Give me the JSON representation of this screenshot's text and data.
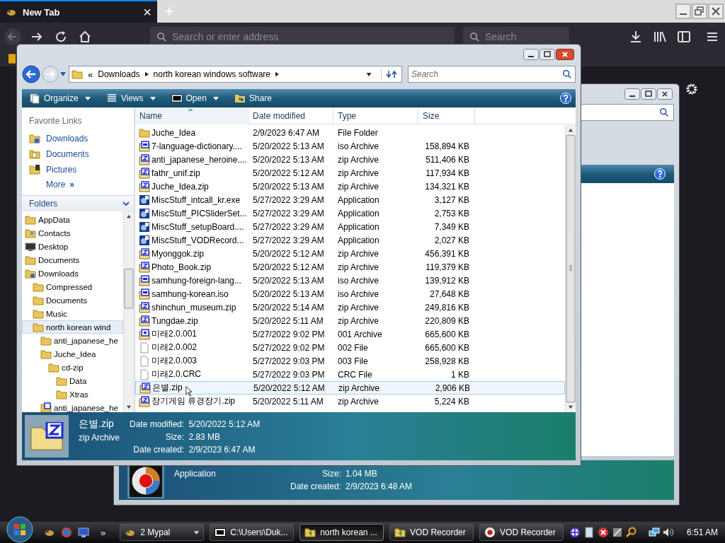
{
  "browser": {
    "tab": {
      "title": "New Tab",
      "close": "×",
      "selected": true
    },
    "new_tab": "+",
    "address": {
      "placeholder": "Search or enter address"
    },
    "search": {
      "placeholder": "Search"
    }
  },
  "back_window": {
    "details": {
      "type": "Application",
      "fields": [
        {
          "label": "Size:",
          "value": "1.04 MB"
        },
        {
          "label": "Date created:",
          "value": "2/9/2023 6:48 AM"
        }
      ]
    }
  },
  "explorer": {
    "breadcrumb_overflow": "«",
    "breadcrumb": [
      "Downloads",
      "north korean windows software"
    ],
    "search": {
      "placeholder": "Search"
    },
    "toolbar": [
      {
        "label": "Organize",
        "kind": "organize",
        "dropdown": true
      },
      {
        "label": "Views",
        "kind": "views",
        "dropdown": true
      },
      {
        "label": "Open",
        "kind": "sevenzip",
        "dropdown": true
      },
      {
        "label": "Share",
        "kind": "share",
        "dropdown": false
      }
    ],
    "favorite_links": {
      "title": "Favorite Links",
      "items": [
        {
          "label": "Downloads",
          "kind": "downloads"
        },
        {
          "label": "Documents",
          "kind": "documents"
        },
        {
          "label": "Pictures",
          "kind": "pictures"
        }
      ],
      "more": "More",
      "more_chevron": "»"
    },
    "folders": {
      "title": "Folders",
      "tree": [
        {
          "label": "AppData",
          "kind": "folder",
          "selected": false
        },
        {
          "label": "Contacts",
          "kind": "contacts",
          "selected": false
        },
        {
          "label": "Desktop",
          "kind": "desktop",
          "selected": false
        },
        {
          "label": "Documents",
          "kind": "folder",
          "selected": false
        },
        {
          "label": "Downloads",
          "kind": "downloads",
          "selected": false,
          "children": [
            {
              "label": "Compressed",
              "kind": "folder",
              "selected": false
            },
            {
              "label": "Documents",
              "kind": "folder",
              "selected": false
            },
            {
              "label": "Music",
              "kind": "folder",
              "selected": false
            },
            {
              "label": "north korean wind",
              "kind": "folder",
              "selected": true,
              "children": [
                {
                  "label": "anti_japanese_he",
                  "kind": "folder",
                  "selected": false
                },
                {
                  "label": "Juche_Idea",
                  "kind": "folder",
                  "selected": false,
                  "children": [
                    {
                      "label": "cd-zip",
                      "kind": "folder",
                      "selected": false,
                      "children": [
                        {
                          "label": "Data",
                          "kind": "folder",
                          "selected": false
                        },
                        {
                          "label": "Xtras",
                          "kind": "folder",
                          "selected": false
                        }
                      ]
                    }
                  ]
                },
                {
                  "label": "anti_japanese_he",
                  "kind": "zip",
                  "selected": false
                }
              ]
            }
          ]
        }
      ]
    },
    "columns": [
      {
        "label": "Name",
        "sorted": true
      },
      {
        "label": "Date modified",
        "sorted": false
      },
      {
        "label": "Type",
        "sorted": false
      },
      {
        "label": "Size",
        "sorted": false
      }
    ],
    "files": [
      {
        "name": "Juche_Idea",
        "date": "2/9/2023 6:47 AM",
        "type": "File Folder",
        "kind": "folder",
        "selected": false
      },
      {
        "name": "7-language-dictionary....",
        "date": "5/20/2022 5:13 AM",
        "type": "iso Archive",
        "size": "158,894 KB",
        "kind": "iso",
        "selected": false
      },
      {
        "name": "anti_japanese_heroine....",
        "date": "5/20/2022 5:13 AM",
        "type": "zip Archive",
        "size": "511,406 KB",
        "kind": "zip",
        "selected": false
      },
      {
        "name": "fathr_unif.zip",
        "date": "5/20/2022 5:12 AM",
        "type": "zip Archive",
        "size": "117,934 KB",
        "kind": "zip",
        "selected": false
      },
      {
        "name": "Juche_Idea.zip",
        "date": "5/20/2022 5:13 AM",
        "type": "zip Archive",
        "size": "134,321 KB",
        "kind": "zip",
        "selected": false
      },
      {
        "name": "MiscStuff_intcall_kr.exe",
        "date": "5/27/2022 3:29 AM",
        "type": "Application",
        "size": "3,127 KB",
        "kind": "app",
        "selected": false
      },
      {
        "name": "MiscStuff_PICSliderSet...",
        "date": "5/27/2022 3:29 AM",
        "type": "Application",
        "size": "2,753 KB",
        "kind": "app",
        "selected": false
      },
      {
        "name": "MiscStuff_setupBoard....",
        "date": "5/27/2022 3:29 AM",
        "type": "Application",
        "size": "7,349 KB",
        "kind": "app",
        "selected": false
      },
      {
        "name": "MiscStuff_VODRecord...",
        "date": "5/27/2022 3:29 AM",
        "type": "Application",
        "size": "2,027 KB",
        "kind": "app",
        "selected": false
      },
      {
        "name": "Myonggok.zip",
        "date": "5/20/2022 5:12 AM",
        "type": "zip Archive",
        "size": "456,391 KB",
        "kind": "zip",
        "selected": false
      },
      {
        "name": "Photo_Book.zip",
        "date": "5/20/2022 5:12 AM",
        "type": "zip Archive",
        "size": "119,379 KB",
        "kind": "zip",
        "selected": false
      },
      {
        "name": "samhung-foreign-lang...",
        "date": "5/20/2022 5:13 AM",
        "type": "iso Archive",
        "size": "139,912 KB",
        "kind": "iso",
        "selected": false
      },
      {
        "name": "samhung-korean.iso",
        "date": "5/20/2022 5:13 AM",
        "type": "iso Archive",
        "size": "27,648 KB",
        "kind": "iso",
        "selected": false
      },
      {
        "name": "shinchun_museum.zip",
        "date": "5/20/2022 5:14 AM",
        "type": "zip Archive",
        "size": "249,816 KB",
        "kind": "zip",
        "selected": false
      },
      {
        "name": "Tungdae.zip",
        "date": "5/20/2022 5:11 AM",
        "type": "zip Archive",
        "size": "220,809 KB",
        "kind": "zip",
        "selected": false
      },
      {
        "name": "미래2.0.001",
        "date": "5/27/2022 9:02 PM",
        "type": "001 Archive",
        "size": "665,600 KB",
        "kind": "split",
        "selected": false
      },
      {
        "name": "미래2.0.002",
        "date": "5/27/2022 9:02 PM",
        "type": "002 File",
        "size": "665,600 KB",
        "kind": "file",
        "selected": false
      },
      {
        "name": "미래2.0.003",
        "date": "5/27/2022 9:03 PM",
        "type": "003 File",
        "size": "258,928 KB",
        "kind": "file",
        "selected": false
      },
      {
        "name": "미래2.0.CRC",
        "date": "5/27/2022 9:03 PM",
        "type": "CRC File",
        "size": "1 KB",
        "kind": "file",
        "selected": false
      },
      {
        "name": "은별.zip",
        "date": "5/20/2022 5:12 AM",
        "type": "zip Archive",
        "size": "2,906 KB",
        "kind": "zip",
        "selected": true
      },
      {
        "name": "장기게임 류경장기.zip",
        "date": "5/20/2022 5:11 AM",
        "type": "zip Archive",
        "size": "5,224 KB",
        "kind": "zip",
        "selected": false
      }
    ],
    "details": {
      "name": "은별.zip",
      "type": "zip Archive",
      "fields": [
        {
          "label": "Date modified:",
          "value": "5/20/2022 5:12 AM"
        },
        {
          "label": "Size:",
          "value": "2.83 MB"
        },
        {
          "label": "Date created:",
          "value": "2/9/2023 6:47 AM"
        }
      ]
    }
  },
  "taskbar": {
    "overflow": "»",
    "buttons": [
      {
        "label": "2 Mypal",
        "kind": "mypal",
        "dropdown": true,
        "selected": false
      },
      {
        "label": "C:\\Users\\Duk...",
        "kind": "sevenzip",
        "dropdown": false,
        "selected": false
      },
      {
        "label": "north korean ...",
        "kind": "folder",
        "dropdown": false,
        "selected": true
      },
      {
        "label": "VOD Recorder",
        "kind": "folder",
        "dropdown": false,
        "selected": false
      },
      {
        "label": "VOD Recorder",
        "kind": "record",
        "dropdown": false,
        "selected": false
      }
    ],
    "clock": "6:51 AM"
  }
}
